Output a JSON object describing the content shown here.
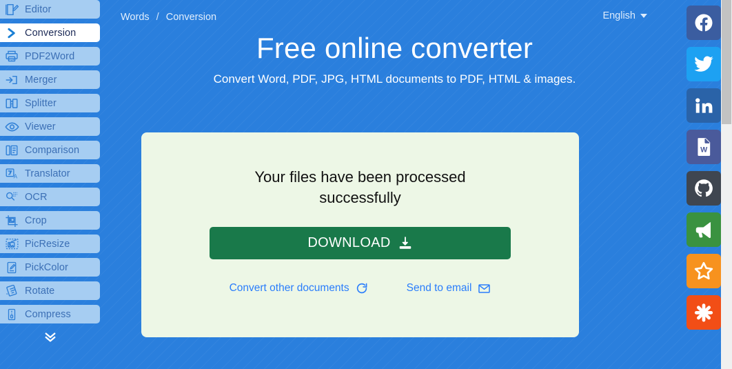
{
  "theme": {
    "page_background": "#2a7fdd",
    "sidebar_item_background": "#a6cdf2",
    "sidebar_item_text": "#3b6fb5",
    "sidebar_active_background": "#ffffff",
    "sidebar_active_text": "#1c2a56",
    "card_background": "#edf7e6",
    "download_button_background": "#19794a",
    "link_color": "#2a7dfb"
  },
  "sidebar": {
    "items": [
      {
        "label": "Editor",
        "icon": "editor-icon",
        "active": false
      },
      {
        "label": "Conversion",
        "icon": "chevron-right-icon",
        "active": true
      },
      {
        "label": "PDF2Word",
        "icon": "pdf-printer-icon",
        "active": false
      },
      {
        "label": "Merger",
        "icon": "merger-icon",
        "active": false
      },
      {
        "label": "Splitter",
        "icon": "splitter-icon",
        "active": false
      },
      {
        "label": "Viewer",
        "icon": "eye-icon",
        "active": false
      },
      {
        "label": "Comparison",
        "icon": "comparison-icon",
        "active": false
      },
      {
        "label": "Translator",
        "icon": "translator-icon",
        "active": false
      },
      {
        "label": "OCR",
        "icon": "ocr-icon",
        "active": false
      },
      {
        "label": "Crop",
        "icon": "crop-icon",
        "active": false
      },
      {
        "label": "PicResize",
        "icon": "picresize-icon",
        "active": false
      },
      {
        "label": "PickColor",
        "icon": "pickcolor-icon",
        "active": false
      },
      {
        "label": "Rotate",
        "icon": "rotate-icon",
        "active": false
      },
      {
        "label": "Compress",
        "icon": "compress-icon",
        "active": false
      }
    ],
    "more_icon": "chevrons-down-icon"
  },
  "topbar": {
    "breadcrumb": {
      "root": "Words",
      "separator": "/",
      "current": "Conversion"
    },
    "language": {
      "label": "English",
      "caret_icon": "chevron-down-icon"
    }
  },
  "hero": {
    "title": "Free online converter",
    "subtitle": "Convert Word, PDF, JPG, HTML documents to PDF, HTML & images."
  },
  "card": {
    "status_message": "Your files have been processed successfully",
    "download_label": "DOWNLOAD",
    "download_icon": "download-icon",
    "links": [
      {
        "label": "Convert other documents",
        "icon": "refresh-icon"
      },
      {
        "label": "Send to email",
        "icon": "envelope-icon"
      }
    ]
  },
  "social_rail": {
    "items": [
      {
        "name": "facebook",
        "icon": "facebook-icon",
        "color": "#3b5da0"
      },
      {
        "name": "twitter",
        "icon": "twitter-icon",
        "color": "#1da1f2"
      },
      {
        "name": "linkedin",
        "icon": "linkedin-icon",
        "color": "#2a63a8"
      },
      {
        "name": "word",
        "icon": "word-doc-icon",
        "color": "#4a5a9b"
      },
      {
        "name": "github",
        "icon": "github-icon",
        "color": "#3f4650"
      },
      {
        "name": "announce",
        "icon": "megaphone-icon",
        "color": "#3a9240"
      },
      {
        "name": "favorite",
        "icon": "star-icon",
        "color": "#f7921e"
      },
      {
        "name": "asterisk",
        "icon": "asterisk-icon",
        "color": "#f24e16"
      }
    ]
  },
  "scrollbar": {
    "thumb_top": 0,
    "thumb_height": 180
  }
}
